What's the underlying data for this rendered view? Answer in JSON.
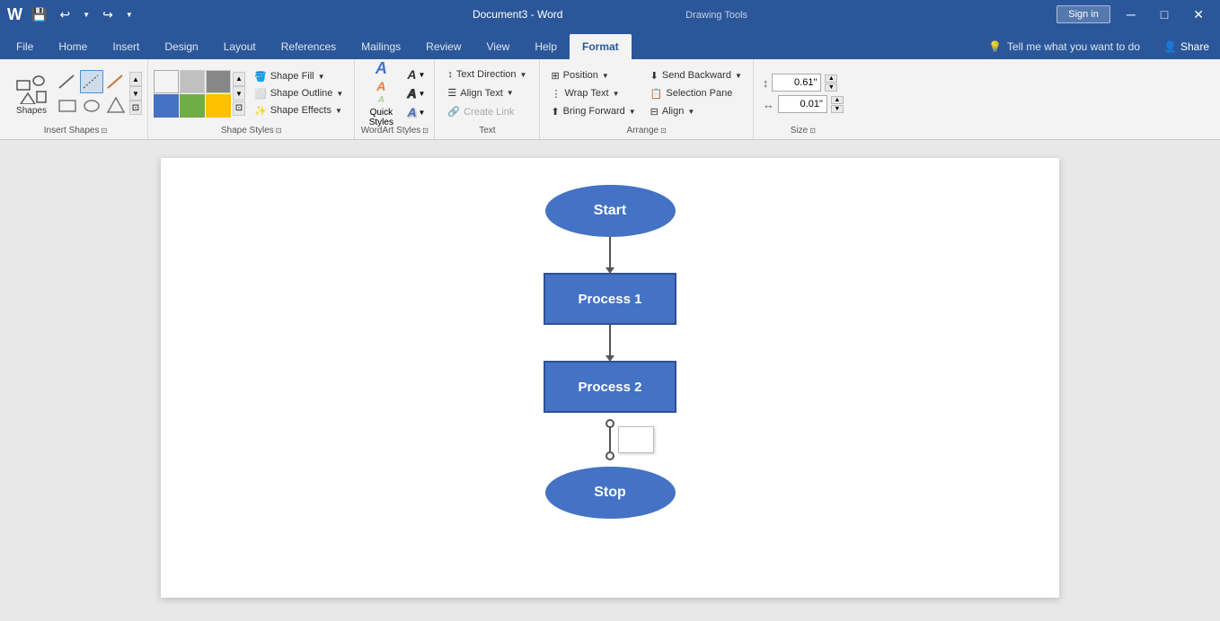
{
  "titlebar": {
    "title": "Document3 - Word",
    "drawing_tools": "Drawing Tools",
    "sign_in": "Sign in",
    "save_icon": "💾",
    "undo_icon": "↩",
    "redo_icon": "↪"
  },
  "tabs": {
    "items": [
      "File",
      "Home",
      "Insert",
      "Design",
      "Layout",
      "References",
      "Mailings",
      "Review",
      "View",
      "Help"
    ],
    "active": "Format",
    "format": "Format"
  },
  "tell_me": {
    "placeholder": "Tell me what you want to do",
    "icon": "💡"
  },
  "share": {
    "label": "Share",
    "icon": "👤"
  },
  "ribbon": {
    "groups": {
      "insert_shapes": {
        "label": "Insert Shapes",
        "shapes_label": "Shapes"
      },
      "shape_styles": {
        "label": "Shape Styles",
        "fill": "Shape Fill",
        "outline": "Shape Outline",
        "effects": "Shape Effects"
      },
      "wordart_styles": {
        "label": "WordArt Styles",
        "quick_styles": "Quick Styles"
      },
      "text": {
        "label": "Text",
        "direction": "Text Direction",
        "align": "Align Text",
        "create_link": "Create Link"
      },
      "arrange": {
        "label": "Arrange",
        "position": "Position",
        "send_backward": "Send Backward",
        "selection_pane": "Selection Pane",
        "wrap_text": "Wrap Text",
        "bring_forward": "Bring Forward",
        "align": "Align"
      },
      "size": {
        "label": "Size",
        "height": "0.61\"",
        "width": "0.01\""
      }
    }
  },
  "flowchart": {
    "start": "Start",
    "process1": "Process 1",
    "process2": "Process 2",
    "stop": "Stop"
  }
}
